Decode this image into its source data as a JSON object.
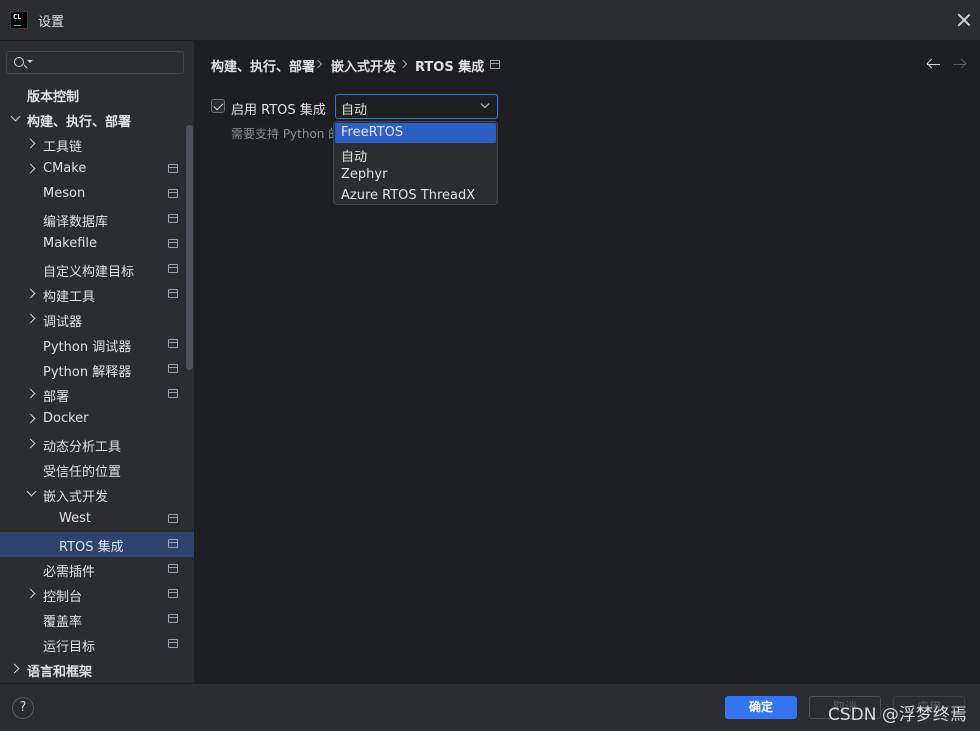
{
  "window": {
    "title": "设置",
    "logo_text": "CL"
  },
  "search": {
    "value": "",
    "placeholder": ""
  },
  "sidebar": {
    "items": [
      {
        "label": "版本控制"
      },
      {
        "label": "构建、执行、部署"
      },
      {
        "label": "工具链"
      },
      {
        "label": "CMake"
      },
      {
        "label": "Meson"
      },
      {
        "label": "编译数据库"
      },
      {
        "label": "Makefile"
      },
      {
        "label": "自定义构建目标"
      },
      {
        "label": "构建工具"
      },
      {
        "label": "调试器"
      },
      {
        "label": "Python 调试器"
      },
      {
        "label": "Python 解释器"
      },
      {
        "label": "部署"
      },
      {
        "label": "Docker"
      },
      {
        "label": "动态分析工具"
      },
      {
        "label": "受信任的位置"
      },
      {
        "label": "嵌入式开发"
      },
      {
        "label": "West"
      },
      {
        "label": "RTOS 集成"
      },
      {
        "label": "必需插件"
      },
      {
        "label": "控制台"
      },
      {
        "label": "覆盖率"
      },
      {
        "label": "运行目标"
      },
      {
        "label": "语言和框架"
      }
    ],
    "selected": "RTOS 集成"
  },
  "breadcrumb": {
    "items": [
      "构建、执行、部署",
      "嵌入式开发",
      "RTOS 集成"
    ]
  },
  "settings": {
    "enable_label": "启用 RTOS 集成",
    "enable_checked": true,
    "hint": "需要支持 Python 的",
    "select_value": "自动",
    "options": [
      "FreeRTOS",
      "自动",
      "Zephyr",
      "Azure RTOS ThreadX"
    ],
    "highlighted_option": "FreeRTOS"
  },
  "footer": {
    "help": "?",
    "ok": "确定",
    "cancel": "取消",
    "apply": "应用"
  },
  "watermark": "CSDN @浮梦终焉",
  "colors": {
    "accent": "#3574f0",
    "background": "#1e1f22",
    "panel": "#2b2d30",
    "selection": "#2e436e"
  }
}
